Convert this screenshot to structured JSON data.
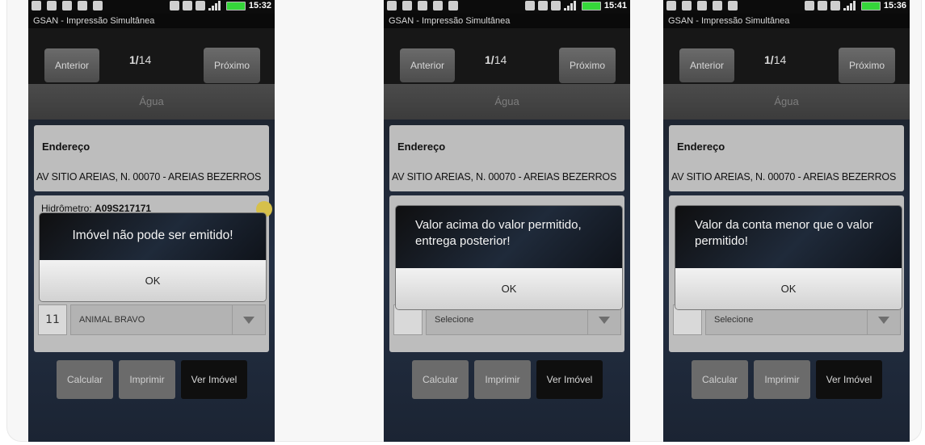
{
  "screens": [
    {
      "time": "15:32",
      "app_title": "GSAN - Impressão Simultânea",
      "prev_label": "Anterior",
      "next_label": "Próximo",
      "counter_current": "1/",
      "counter_total": "14",
      "tab_label": "Água",
      "address_heading": "Endereço",
      "address_value": "AV SITIO AREIAS, N. 00070 - AREIAS BEZERROS",
      "hidrometro_label": "Hidrômetro: ",
      "hidrometro_value": "A09S217171",
      "select_number": "11",
      "select_value": "ANIMAL BRAVO",
      "calc_label": "Calcular",
      "print_label": "Imprimir",
      "view_label": "Ver Imóvel",
      "dialog_message": "Imóvel não pode ser emitido!",
      "dialog_ok": "OK"
    },
    {
      "time": "15:41",
      "app_title": "GSAN - Impressão Simultânea",
      "prev_label": "Anterior",
      "next_label": "Próximo",
      "counter_current": "1/",
      "counter_total": "14",
      "tab_label": "Água",
      "address_heading": "Endereço",
      "address_value": "AV SITIO AREIAS, N. 00070 - AREIAS BEZERROS",
      "select_value": "Selecione",
      "calc_label": "Calcular",
      "print_label": "Imprimir",
      "view_label": "Ver Imóvel",
      "dialog_message": "Valor acima do valor permitido, entrega posterior!",
      "dialog_ok": "OK"
    },
    {
      "time": "15:36",
      "app_title": "GSAN - Impressão Simultânea",
      "prev_label": "Anterior",
      "next_label": "Próximo",
      "counter_current": "1/",
      "counter_total": "14",
      "tab_label": "Água",
      "address_heading": "Endereço",
      "address_value": "AV SITIO AREIAS, N. 00070 - AREIAS BEZERROS",
      "select_value": "Selecione",
      "calc_label": "Calcular",
      "print_label": "Imprimir",
      "view_label": "Ver Imóvel",
      "dialog_message": "Valor da conta menor que o valor permitido!",
      "dialog_ok": "OK"
    }
  ],
  "status_icons": [
    "mail-icon",
    "sync-icon",
    "refresh-icon",
    "usb-icon",
    "sd-card-icon",
    "bluetooth-icon",
    "vibrate-icon",
    "sim-icon",
    "signal-icon",
    "battery-icon"
  ],
  "colors": {
    "battery": "#35d63a",
    "dialog_dark": "#1f2a3a",
    "card": "#bdbdbd"
  }
}
